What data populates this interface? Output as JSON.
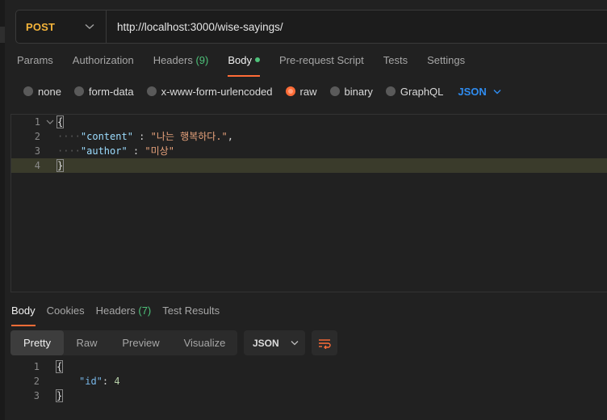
{
  "request": {
    "method": "POST",
    "url": "http://localhost:3000/wise-sayings/"
  },
  "request_tabs": {
    "params": "Params",
    "authorization": "Authorization",
    "headers": "Headers",
    "headers_count": "(9)",
    "body": "Body",
    "prerequest": "Pre-request Script",
    "tests": "Tests",
    "settings": "Settings"
  },
  "body_types": {
    "none": "none",
    "form_data": "form-data",
    "urlencoded": "x-www-form-urlencoded",
    "raw": "raw",
    "binary": "binary",
    "graphql": "GraphQL",
    "language": "JSON",
    "selected": "raw"
  },
  "request_body": {
    "line_numbers": [
      "1",
      "2",
      "3",
      "4"
    ],
    "open_brace": "{",
    "close_brace": "}",
    "indent": "····",
    "content_key": "\"content\"",
    "content_colon": " : ",
    "content_value": "\"나는 행복하다.\"",
    "content_comma": ",",
    "author_key": "\"author\"",
    "author_colon": " : ",
    "author_value": "\"미상\""
  },
  "response_tabs": {
    "body": "Body",
    "cookies": "Cookies",
    "headers": "Headers",
    "headers_count": "(7)",
    "test_results": "Test Results"
  },
  "response_view": {
    "pretty": "Pretty",
    "raw": "Raw",
    "preview": "Preview",
    "visualize": "Visualize",
    "language": "JSON"
  },
  "response_body": {
    "line_numbers": [
      "1",
      "2",
      "3"
    ],
    "open_brace": "{",
    "close_brace": "}",
    "id_key": "\"id\"",
    "id_colon": ": ",
    "id_value": "4"
  },
  "icons": {
    "method_dropdown": "chevron-down-icon",
    "language_dropdown": "chevron-down-icon",
    "fold": "chevron-down-icon",
    "wrap": "wrap-lines-icon"
  },
  "colors": {
    "accent": "#ff6c37",
    "method": "#f4b43a",
    "count": "#4ec27a",
    "language": "#2f8cf0"
  }
}
